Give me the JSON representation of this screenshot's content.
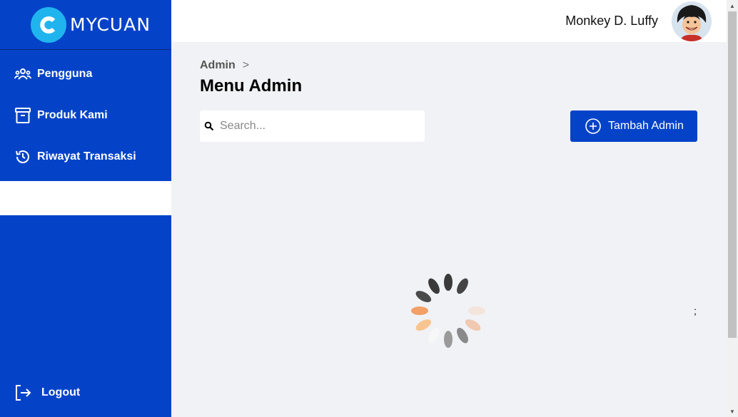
{
  "brand": {
    "name": "MYCUAN"
  },
  "sidebar": {
    "items": [
      {
        "label": "Pengguna",
        "icon": "users-icon"
      },
      {
        "label": "Produk Kami",
        "icon": "archive-box-icon"
      },
      {
        "label": "Riwayat Transaksi",
        "icon": "history-icon"
      }
    ],
    "logout_label": "Logout"
  },
  "header": {
    "user_name": "Monkey D. Luffy"
  },
  "main": {
    "breadcrumb": {
      "root": "Admin",
      "separator": ">"
    },
    "title": "Menu Admin",
    "search": {
      "placeholder": "Search..."
    },
    "add_button_label": "Tambah Admin",
    "stray_text": ";"
  },
  "colors": {
    "primary": "#0443c8",
    "brand_logo": "#20b4ee",
    "background": "#f1f2f5"
  }
}
